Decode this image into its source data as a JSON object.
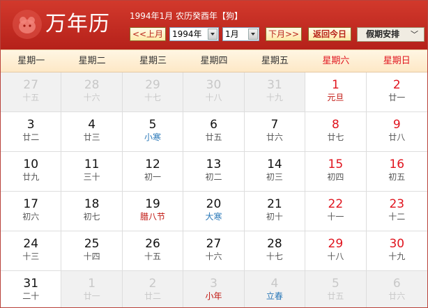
{
  "header": {
    "app_title": "万年历",
    "lunar_info": "1994年1月 农历癸酉年【狗】",
    "prev_month_label": "<<上月",
    "year_select_value": "1994年",
    "month_select_value": "1月",
    "next_month_label": "下月>>",
    "today_label": "返回今日",
    "holiday_label": "假期安排",
    "holiday_chevron": "﹀"
  },
  "weekdays": [
    "星期一",
    "星期二",
    "星期三",
    "星期四",
    "星期五",
    "星期六",
    "星期日"
  ],
  "days": [
    {
      "day": "27",
      "lunar": "十五",
      "other": true
    },
    {
      "day": "28",
      "lunar": "十六",
      "other": true
    },
    {
      "day": "29",
      "lunar": "十七",
      "other": true
    },
    {
      "day": "30",
      "lunar": "十八",
      "other": true
    },
    {
      "day": "31",
      "lunar": "十九",
      "other": true
    },
    {
      "day": "1",
      "lunar": "元旦",
      "lunar_color": "red"
    },
    {
      "day": "2",
      "lunar": "廿一"
    },
    {
      "day": "3",
      "lunar": "廿二"
    },
    {
      "day": "4",
      "lunar": "廿三"
    },
    {
      "day": "5",
      "lunar": "小寒",
      "lunar_color": "blue"
    },
    {
      "day": "6",
      "lunar": "廿五"
    },
    {
      "day": "7",
      "lunar": "廿六"
    },
    {
      "day": "8",
      "lunar": "廿七"
    },
    {
      "day": "9",
      "lunar": "廿八"
    },
    {
      "day": "10",
      "lunar": "廿九"
    },
    {
      "day": "11",
      "lunar": "三十"
    },
    {
      "day": "12",
      "lunar": "初一"
    },
    {
      "day": "13",
      "lunar": "初二"
    },
    {
      "day": "14",
      "lunar": "初三"
    },
    {
      "day": "15",
      "lunar": "初四"
    },
    {
      "day": "16",
      "lunar": "初五"
    },
    {
      "day": "17",
      "lunar": "初六"
    },
    {
      "day": "18",
      "lunar": "初七"
    },
    {
      "day": "19",
      "lunar": "腊八节",
      "lunar_color": "red"
    },
    {
      "day": "20",
      "lunar": "大寒",
      "lunar_color": "blue"
    },
    {
      "day": "21",
      "lunar": "初十"
    },
    {
      "day": "22",
      "lunar": "十一"
    },
    {
      "day": "23",
      "lunar": "十二"
    },
    {
      "day": "24",
      "lunar": "十三"
    },
    {
      "day": "25",
      "lunar": "十四"
    },
    {
      "day": "26",
      "lunar": "十五"
    },
    {
      "day": "27",
      "lunar": "十六"
    },
    {
      "day": "28",
      "lunar": "十七"
    },
    {
      "day": "29",
      "lunar": "十八"
    },
    {
      "day": "30",
      "lunar": "十九"
    },
    {
      "day": "31",
      "lunar": "二十"
    },
    {
      "day": "1",
      "lunar": "廿一",
      "other": true
    },
    {
      "day": "2",
      "lunar": "廿二",
      "other": true
    },
    {
      "day": "3",
      "lunar": "小年",
      "lunar_color": "red",
      "other": true
    },
    {
      "day": "4",
      "lunar": "立春",
      "lunar_color": "blue",
      "other": true
    },
    {
      "day": "5",
      "lunar": "廿五",
      "other": true
    },
    {
      "day": "6",
      "lunar": "廿六",
      "other": true
    }
  ],
  "colors": {
    "header_red": "#c42a20",
    "weekend_red": "#e0141e",
    "solar_term_blue": "#2a78b8",
    "festival_red": "#c0150f"
  }
}
